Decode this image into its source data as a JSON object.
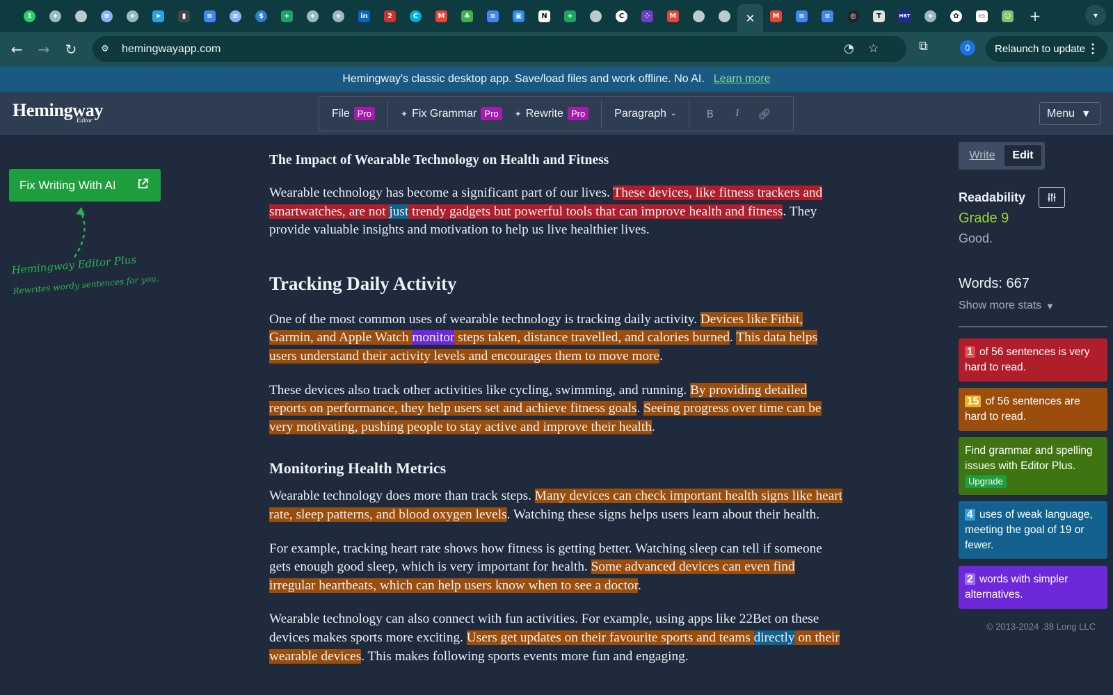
{
  "browser": {
    "tabs": [
      {
        "icon": "whatsapp-icon",
        "color": "#25d366",
        "glyph": "1"
      },
      {
        "icon": "tab-group-icon",
        "color": "#9bb",
        "glyph": "+"
      },
      {
        "icon": "globe-icon",
        "color": "#bcc",
        "glyph": ""
      },
      {
        "icon": "list-icon",
        "color": "#8ab4f8",
        "glyph": "≡"
      },
      {
        "icon": "tab-group-icon",
        "color": "#9bb",
        "glyph": "+"
      },
      {
        "icon": "telegram-icon",
        "color": "#2aa3e0",
        "glyph": "➤"
      },
      {
        "icon": "notification-icon",
        "color": "#444",
        "glyph": "▮"
      },
      {
        "icon": "docs-icon",
        "color": "#4285f4",
        "glyph": "≡"
      },
      {
        "icon": "list-icon",
        "color": "#8ab4f8",
        "glyph": "≡"
      },
      {
        "icon": "dollar-icon",
        "color": "#2d7dd2",
        "glyph": "$"
      },
      {
        "icon": "sheets-plus-icon",
        "color": "#1ea362",
        "glyph": "+"
      },
      {
        "icon": "tab-group-icon",
        "color": "#9bb",
        "glyph": "+"
      },
      {
        "icon": "tab-group-icon",
        "color": "#9bb",
        "glyph": "+"
      },
      {
        "icon": "linkedin-icon",
        "color": "#0a66c2",
        "glyph": "in"
      },
      {
        "icon": "badge-two-icon",
        "color": "#d32f2f",
        "glyph": "2"
      },
      {
        "icon": "chat-icon",
        "color": "#00b3d6",
        "glyph": "C"
      },
      {
        "icon": "gmail-icon",
        "color": "#ea4335",
        "glyph": "M"
      },
      {
        "icon": "clover-icon",
        "color": "#3bb54a",
        "glyph": "♣"
      },
      {
        "icon": "docs-icon",
        "color": "#4285f4",
        "glyph": "≡"
      },
      {
        "icon": "notes-icon",
        "color": "#2d8cf0",
        "glyph": "▣"
      },
      {
        "icon": "notion-icon",
        "color": "#ffffff",
        "glyph": "N"
      },
      {
        "icon": "sheets-plus-icon",
        "color": "#1ea362",
        "glyph": "+"
      },
      {
        "icon": "globe-icon",
        "color": "#bcc",
        "glyph": ""
      },
      {
        "icon": "c-icon",
        "color": "#ffffff",
        "glyph": "C"
      },
      {
        "icon": "dots-icon",
        "color": "#6c3fc5",
        "glyph": "⁘"
      },
      {
        "icon": "gmail-icon",
        "color": "#ea4335",
        "glyph": "M"
      },
      {
        "icon": "globe-icon",
        "color": "#bcc",
        "glyph": ""
      },
      {
        "icon": "globe-icon",
        "color": "#bcc",
        "glyph": ""
      },
      {
        "icon": "close-icon",
        "color": "#ffffff",
        "glyph": "✕",
        "active": true
      },
      {
        "icon": "gmail-icon",
        "color": "#ea4335",
        "glyph": "M"
      },
      {
        "icon": "docs-icon",
        "color": "#4285f4",
        "glyph": "≡"
      },
      {
        "icon": "docs-icon",
        "color": "#4285f4",
        "glyph": "≡"
      },
      {
        "icon": "ring-icon",
        "color": "#222",
        "glyph": "◎"
      },
      {
        "icon": "t-icon",
        "color": "#e0e0e0",
        "glyph": "T"
      },
      {
        "icon": "hbt-icon",
        "color": "#1d2b8a",
        "glyph": "HBT"
      },
      {
        "icon": "tab-group-icon",
        "color": "#9bb",
        "glyph": "+"
      },
      {
        "icon": "openai-icon",
        "color": "#ffffff",
        "glyph": "✿"
      },
      {
        "icon": "card-icon",
        "color": "#ffffff",
        "glyph": "▭"
      },
      {
        "icon": "robot-icon",
        "color": "#7cc36b",
        "glyph": "☺"
      }
    ],
    "new_tab": "+",
    "url": "hemingwayapp.com",
    "profile_count": "0",
    "relaunch_label": "Relaunch to update"
  },
  "announcement": {
    "text": "Hemingway's classic desktop app. Save/load files and work offline. No AI.",
    "link": "Learn more"
  },
  "header": {
    "logo": "Hemingway",
    "logo_sub": "Editor",
    "file": "File",
    "fix_grammar": "Fix Grammar",
    "rewrite": "Rewrite",
    "pro_badge": "Pro",
    "paragraph": "Paragraph",
    "bold": "B",
    "italic": "I",
    "menu": "Menu"
  },
  "sidebar": {
    "ai_button": "Fix Writing With AI",
    "promo_title": "Hemingway Editor Plus",
    "promo_sub": "Rewrites wordy sentences for you."
  },
  "document": {
    "title": "The Impact of Wearable Technology on Health and Fitness",
    "p1": [
      {
        "t": "Wearable technology has become a significant part of our lives. "
      },
      {
        "t": "These devices, like fitness trackers and smartwatches, are not ",
        "hl": "red"
      },
      {
        "t": "just",
        "hl": "blue"
      },
      {
        "t": " trendy gadgets but powerful tools that can improve health and fitness",
        "hl": "red"
      },
      {
        "t": ". They provide valuable insights and motivation to help us live healthier lives."
      }
    ],
    "h2": "Tracking Daily Activity",
    "p2": [
      {
        "t": "One of the most common uses of wearable technology is tracking daily activity. "
      },
      {
        "t": "Devices like Fitbit, Garmin, and Apple Watch ",
        "hl": "orange"
      },
      {
        "t": "monitor",
        "hl": "purple"
      },
      {
        "t": " steps taken, distance travelled, and calories burned",
        "hl": "orange"
      },
      {
        "t": ". "
      },
      {
        "t": "This data helps users understand their activity levels and encourages them to move more",
        "hl": "orange"
      },
      {
        "t": "."
      }
    ],
    "p3": [
      {
        "t": "These devices also track other activities like cycling, swimming, and running. "
      },
      {
        "t": "By providing detailed reports on performance, they help users set and achieve fitness goals",
        "hl": "orange"
      },
      {
        "t": ". "
      },
      {
        "t": "Seeing progress over time can be very motivating, pushing people to stay active and improve their health",
        "hl": "orange"
      },
      {
        "t": "."
      }
    ],
    "h3": "Monitoring Health Metrics",
    "p4": [
      {
        "t": "Wearable technology does more than track steps. "
      },
      {
        "t": "Many devices can check important health signs like heart rate, sleep patterns, and blood oxygen levels",
        "hl": "orange"
      },
      {
        "t": ". Watching these signs helps users learn about their health."
      }
    ],
    "p5": [
      {
        "t": "For example, tracking heart rate shows how fitness is getting better. Watching sleep can tell if someone gets enough good sleep, which is very important for health. "
      },
      {
        "t": "Some advanced devices can even find irregular heartbeats, which can help users know when to see a doctor",
        "hl": "orange"
      },
      {
        "t": "."
      }
    ],
    "p6": [
      {
        "t": "Wearable technology can also connect with fun activities. For example, using apps like 22Bet on these devices makes sports more exciting. "
      },
      {
        "t": "Users get updates on their favourite sports and teams ",
        "hl": "orange"
      },
      {
        "t": "directly",
        "hl": "blue"
      },
      {
        "t": " on their wearable devices",
        "hl": "orange"
      },
      {
        "t": ". This makes following sports events more fun and engaging."
      }
    ]
  },
  "panel": {
    "write": "Write",
    "edit": "Edit",
    "readability": "Readability",
    "grade": "Grade 9",
    "grade_desc": "Good.",
    "words": "Words: 667",
    "more_stats": "Show more stats",
    "card_very_hard_num": "1",
    "card_very_hard_text": "of 56 sentences is very hard to read.",
    "card_hard_num": "15",
    "card_hard_text": "of 56 sentences are hard to read.",
    "card_grammar_text": "Find grammar and spelling issues with Editor Plus.",
    "upgrade": "Upgrade",
    "card_weak_num": "4",
    "card_weak_text": "uses of weak language, meeting the goal of 19 or fewer.",
    "card_simpler_num": "2",
    "card_simpler_text": "words with simpler alternatives.",
    "copyright": "© 2013-2024 .38 Long LLC"
  },
  "colors": {
    "very_hard": "#b01e2b",
    "hard": "#9b4e0c",
    "grammar": "#3f7413",
    "weak": "#13618e",
    "simpler": "#6d28d9",
    "grade": "#9ed63a"
  }
}
